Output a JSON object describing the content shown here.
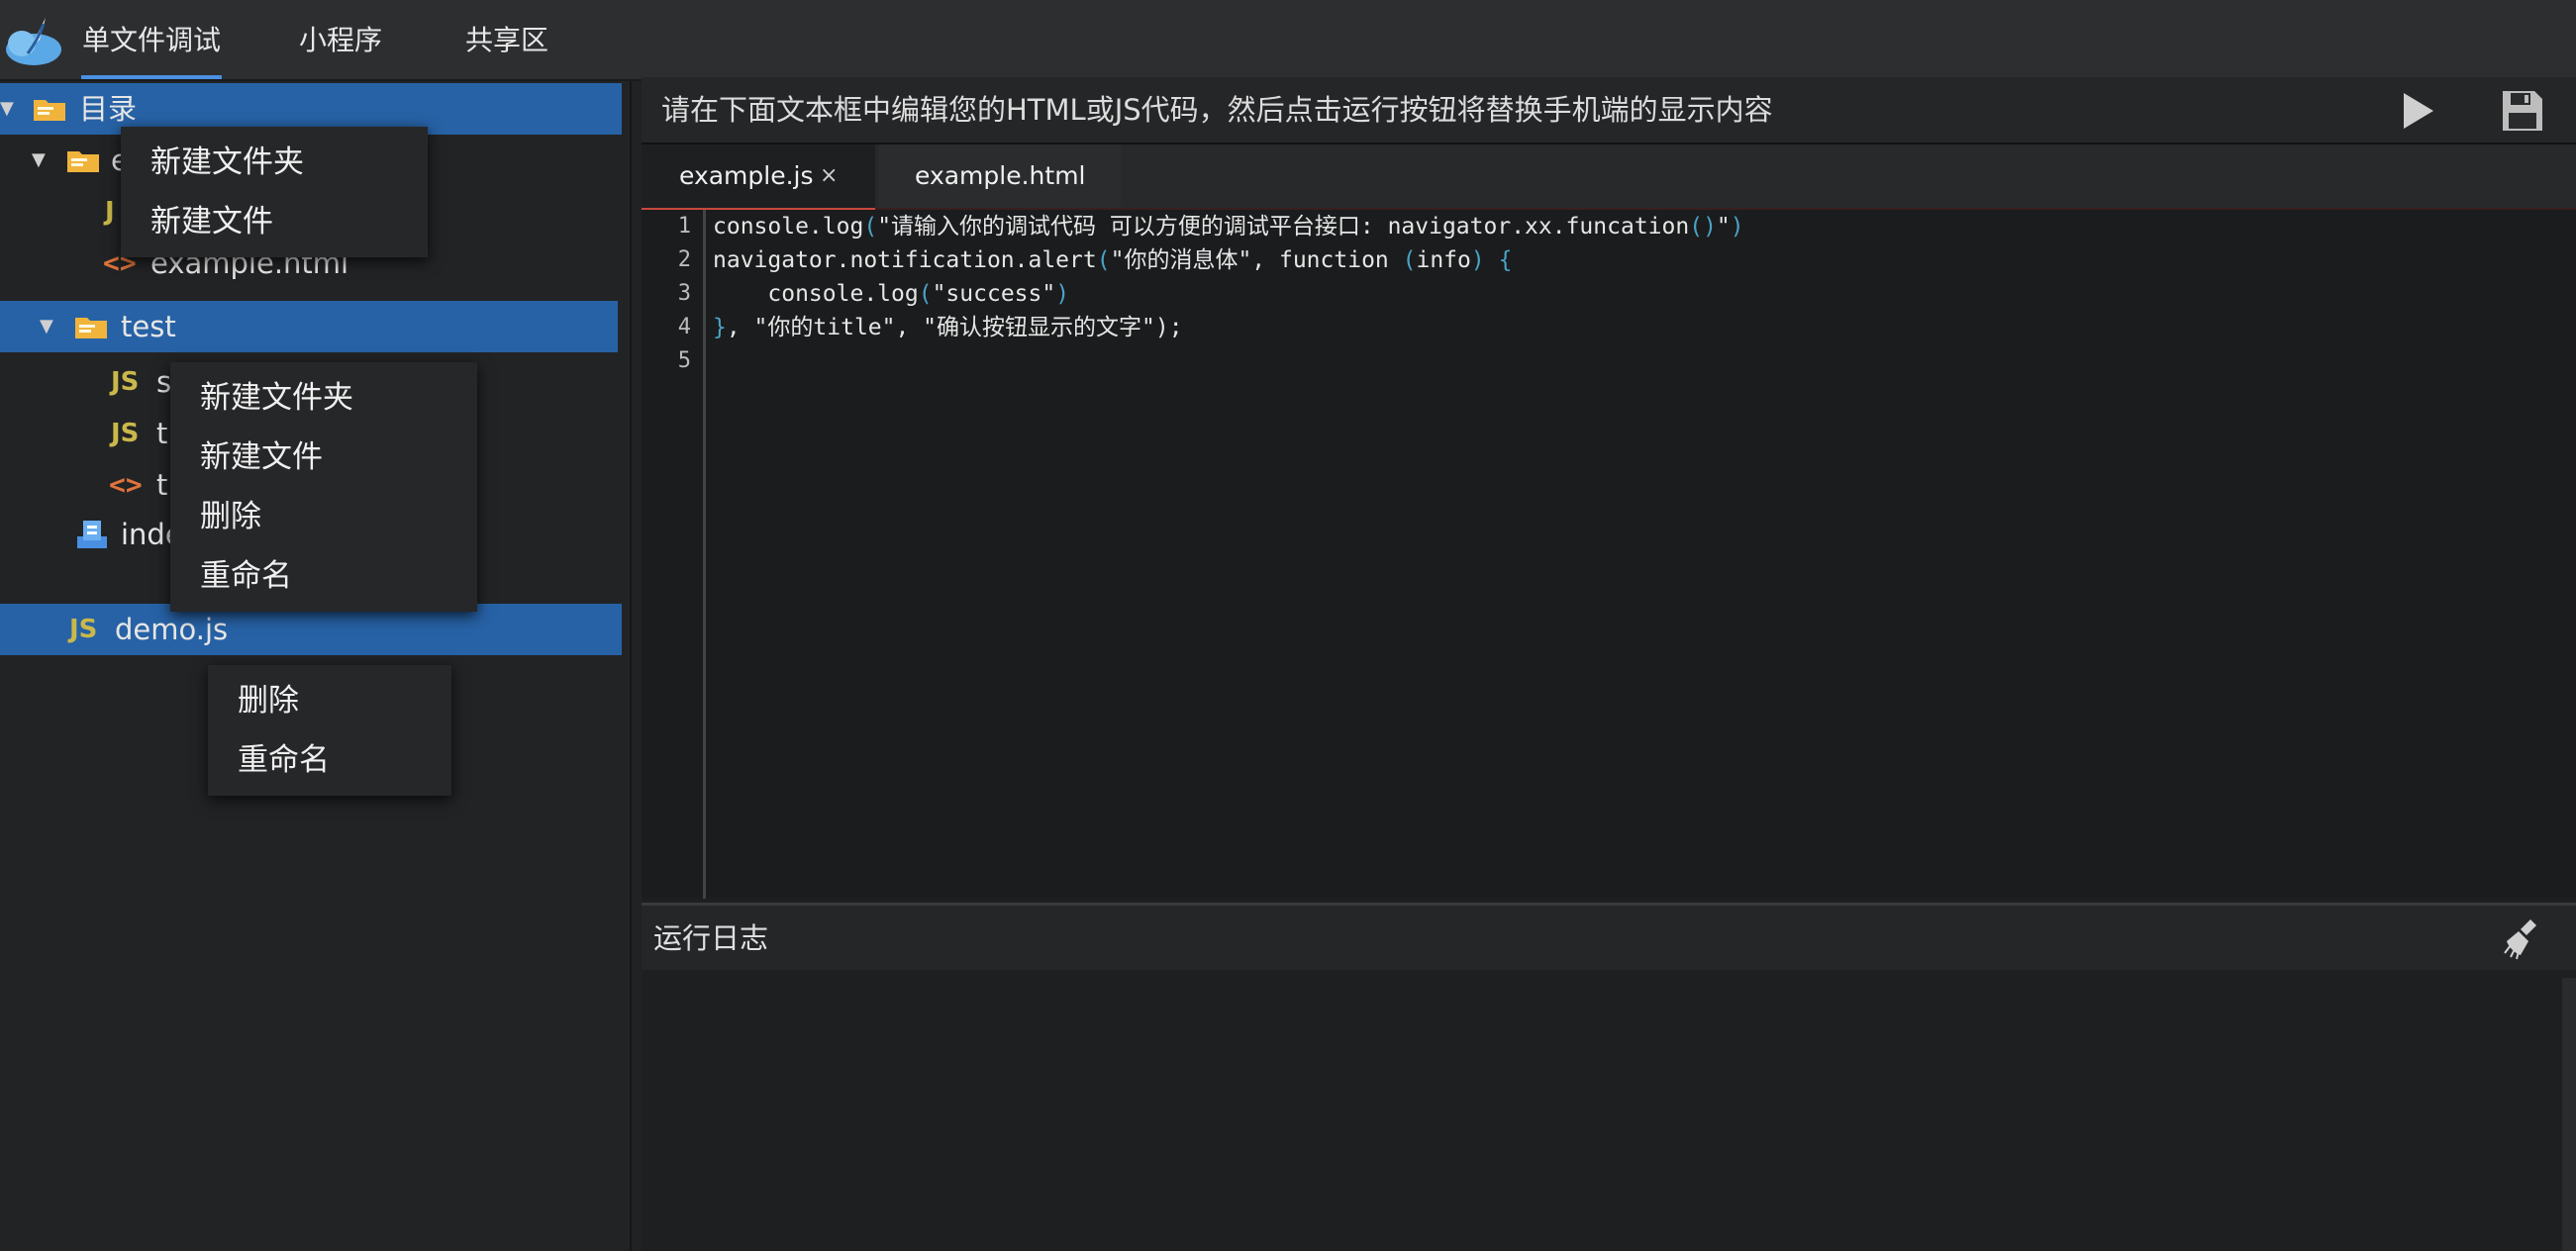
{
  "nav": {
    "tabs": [
      "单文件调试",
      "小程序",
      "共享区"
    ],
    "active": 0
  },
  "tree": {
    "root_label": "目录",
    "root_folder_partial": "e",
    "example_js_partial": "J",
    "example_html": "example.html",
    "test_folder": "test",
    "test_file1_partial": "s",
    "test_file2_partial": "t",
    "test_file3_partial": "t",
    "index_partial": "inde",
    "demo_js": "demo.js",
    "js_icon_text": "JS",
    "html_icon_text": "<>"
  },
  "menus": {
    "root_menu": [
      "新建文件夹",
      "新建文件"
    ],
    "test_menu": [
      "新建文件夹",
      "新建文件",
      "删除",
      "重命名"
    ],
    "file_menu": [
      "删除",
      "重命名"
    ]
  },
  "editor": {
    "hint": "请在下面文本框中编辑您的HTML或JS代码，然后点击运行按钮将替换手机端的显示内容",
    "run_icon": "play-icon",
    "save_icon": "floppy-disk-icon",
    "tabs": [
      {
        "label": "example.js",
        "close": "×"
      },
      {
        "label": "example.html"
      }
    ],
    "line_numbers": [
      "1",
      "2",
      "3",
      "4",
      "5"
    ],
    "code": {
      "l1a": "console.log",
      "l1b": "(",
      "l1c": "\"请输入你的调试代码 可以方便的调试平台接口: navigator.xx.funcation",
      "l1d": "()",
      "l1e": "\"",
      "l1f": ")",
      "l2a": "navigator.notification.alert",
      "l2b": "(",
      "l2c": "\"你的消息体\", function ",
      "l2d": "(",
      "l2e": "info",
      "l2f": ")",
      "l2g": " {",
      "l3a": "    console.log",
      "l3b": "(",
      "l3c": "\"success\"",
      "l3d": ")",
      "l4a": "}",
      "l4b": ", \"你的title\", \"确认按钮显示的文字\"",
      "l4c": ");"
    }
  },
  "log": {
    "title": "运行日志",
    "clear_icon": "broom-icon"
  },
  "colors": {
    "selection": "#2762a6",
    "accent": "#4a90e2",
    "tab_underline": "#c9483c",
    "folder": "#f0b43c",
    "js": "#c9b84a",
    "html": "#e0743a"
  }
}
